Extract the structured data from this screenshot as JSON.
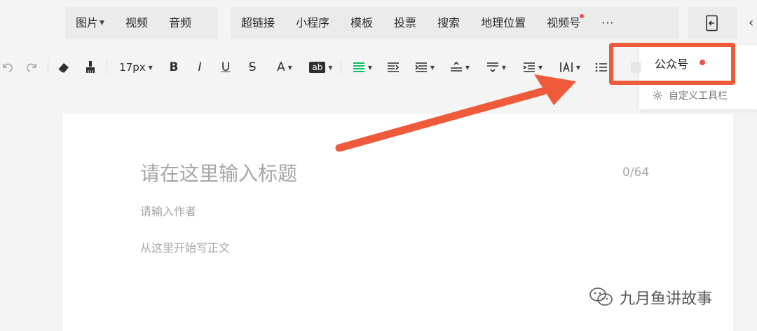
{
  "insert_bar": {
    "group1": [
      {
        "label": "图片",
        "has_caret": true
      },
      {
        "label": "视频"
      },
      {
        "label": "音频"
      }
    ],
    "group2": [
      {
        "label": "超链接"
      },
      {
        "label": "小程序"
      },
      {
        "label": "模板"
      },
      {
        "label": "投票"
      },
      {
        "label": "搜索"
      },
      {
        "label": "地理位置"
      },
      {
        "label": "视频号",
        "has_dot": true
      },
      {
        "label": "···"
      }
    ]
  },
  "toolbar": {
    "font_size": "17px",
    "bold": "B",
    "italic": "I",
    "underline": "U",
    "strike": "S",
    "font_color": "A",
    "bg_color": "ab"
  },
  "dropdown": {
    "items": [
      {
        "label": "公众号",
        "has_dot": true
      },
      {
        "label": "自定义工具栏",
        "icon": "gear-icon"
      }
    ]
  },
  "editor": {
    "title_placeholder": "请在这里输入标题",
    "title_counter": "0/64",
    "author_placeholder": "请输入作者",
    "body_placeholder": "从这里开始写正文"
  },
  "watermark": {
    "text": "九月鱼讲故事"
  },
  "colors": {
    "accent_green": "#07c160",
    "highlight_red": "#ee5a3a",
    "dot_red": "#f24e4e",
    "placeholder_gray": "#a6a6a6"
  }
}
